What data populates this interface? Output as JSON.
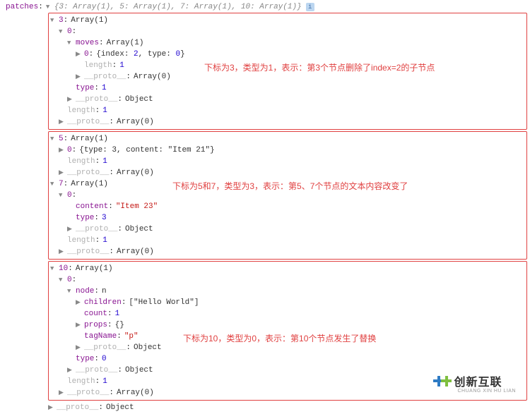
{
  "root": {
    "label": "patches",
    "summary": "{3: Array(1), 5: Array(1), 7: Array(1), 10: Array(1)}"
  },
  "box1": {
    "header": {
      "key": "3",
      "val": "Array(1)"
    },
    "zero": "0",
    "moves": {
      "key": "moves",
      "val": "Array(1)"
    },
    "movesItem": {
      "idx": "0",
      "content": "{index: 2, type: 0}"
    },
    "movesItemIndex": "2",
    "movesItemType": "0",
    "length_moves": {
      "key": "length",
      "val": "1"
    },
    "proto_moves": {
      "key": "__proto__",
      "val": "Array(0)"
    },
    "type": {
      "key": "type",
      "val": "1"
    },
    "proto_obj": {
      "key": "__proto__",
      "val": "Object"
    },
    "length": {
      "key": "length",
      "val": "1"
    },
    "proto_arr": {
      "key": "__proto__",
      "val": "Array(0)"
    },
    "annotation": "下标为3，类型为1，表示：第3个节点删除了index=2的子节点"
  },
  "box2": {
    "h5": {
      "key": "5",
      "val": "Array(1)"
    },
    "h5item": {
      "idx": "0",
      "content": "{type: 3, content: \"Item 21\"}"
    },
    "h5len": {
      "key": "length",
      "val": "1"
    },
    "h5proto": {
      "key": "__proto__",
      "val": "Array(0)"
    },
    "h7": {
      "key": "7",
      "val": "Array(1)"
    },
    "h7zero": "0",
    "h7content": {
      "key": "content",
      "val": "\"Item 23\""
    },
    "h7type": {
      "key": "type",
      "val": "3"
    },
    "h7protoObj": {
      "key": "__proto__",
      "val": "Object"
    },
    "h7len": {
      "key": "length",
      "val": "1"
    },
    "h7proto": {
      "key": "__proto__",
      "val": "Array(0)"
    },
    "annotation": "下标为5和7，类型为3，表示：第5、7个节点的文本内容改变了"
  },
  "box3": {
    "h10": {
      "key": "10",
      "val": "Array(1)"
    },
    "zero": "0",
    "node": {
      "key": "node",
      "val": "n"
    },
    "children": {
      "key": "children",
      "val": "[\"Hello World\"]"
    },
    "count": {
      "key": "count",
      "val": "1"
    },
    "props": {
      "key": "props",
      "val": "{}"
    },
    "tagName": {
      "key": "tagName",
      "val": "\"p\""
    },
    "protoObj": {
      "key": "__proto__",
      "val": "Object"
    },
    "type": {
      "key": "type",
      "val": "0"
    },
    "protoObj2": {
      "key": "__proto__",
      "val": "Object"
    },
    "len": {
      "key": "length",
      "val": "1"
    },
    "protoArr": {
      "key": "__proto__",
      "val": "Array(0)"
    },
    "annotation": "下标为10，类型为0，表示：第10个节点发生了替换"
  },
  "tail": {
    "protoObj": {
      "key": "__proto__",
      "val": "Object"
    }
  },
  "logo": {
    "cn": "创新互联",
    "py": "CHUANG XIN HU LIAN"
  }
}
